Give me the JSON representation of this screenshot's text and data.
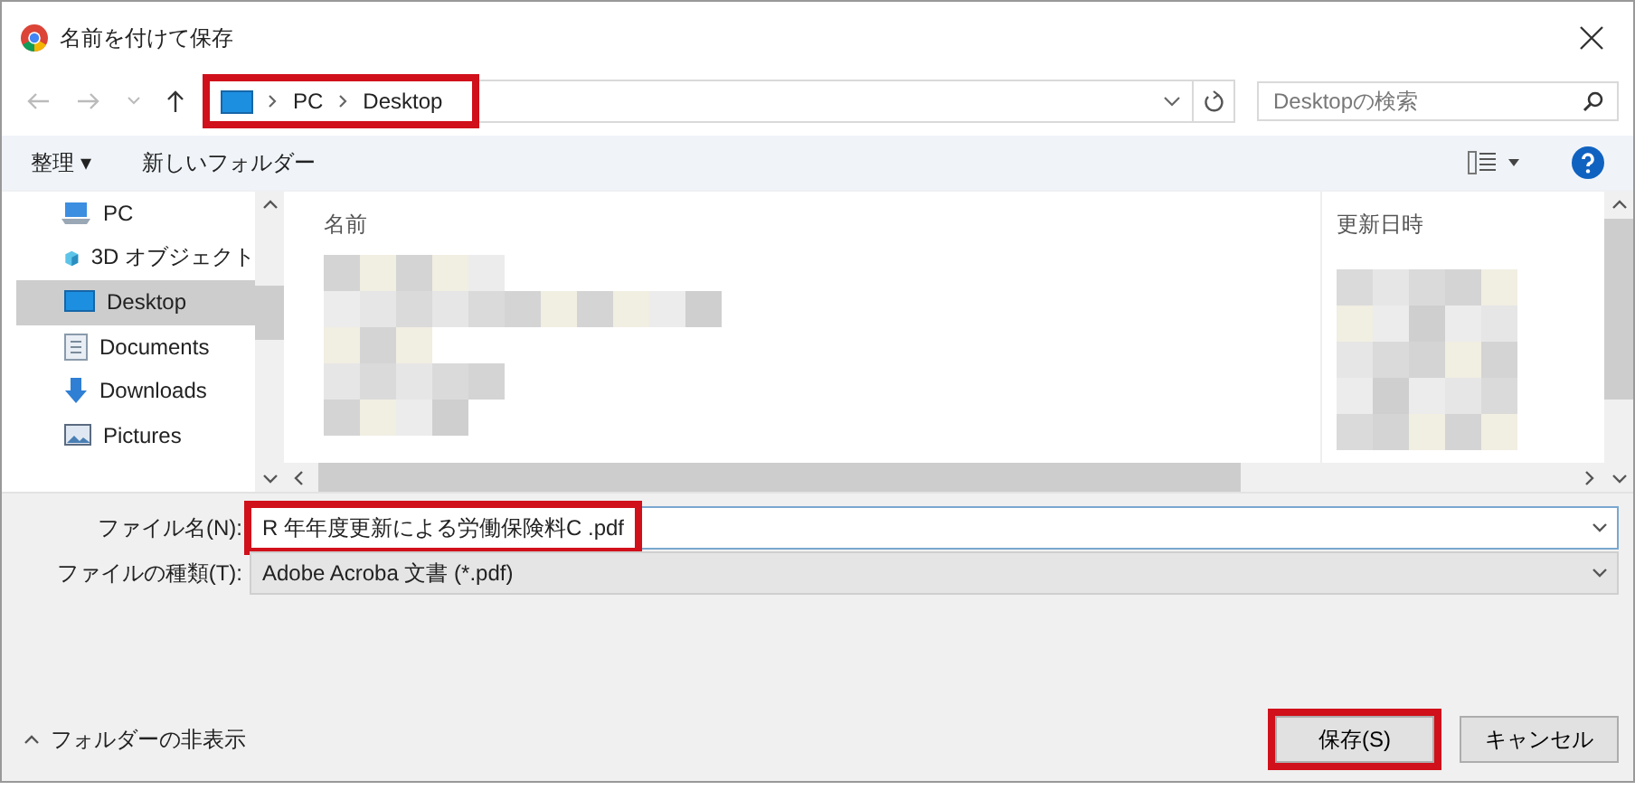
{
  "window": {
    "title": "名前を付けて保存"
  },
  "address_bar": {
    "highlighted": true,
    "crumbs": [
      "PC",
      "Desktop"
    ]
  },
  "search": {
    "placeholder": "Desktopの検索"
  },
  "toolbar": {
    "organize": "整理 ▾",
    "new_folder": "新しいフォルダー"
  },
  "sidebar": {
    "items": [
      {
        "label": "PC",
        "kind": "pc",
        "selected": false
      },
      {
        "label": "3D オブジェクト",
        "kind": "cube",
        "selected": false
      },
      {
        "label": "Desktop",
        "kind": "desktop",
        "selected": true
      },
      {
        "label": "Documents",
        "kind": "document",
        "selected": false
      },
      {
        "label": "Downloads",
        "kind": "download",
        "selected": false
      },
      {
        "label": "Pictures",
        "kind": "pictures",
        "selected": false
      }
    ]
  },
  "file_list": {
    "columns": [
      "名前",
      "更新日時"
    ]
  },
  "file_name": {
    "label": "ファイル名(N):",
    "value": "R 年年度更新による労働保険料C .pdf",
    "highlighted": true
  },
  "file_type": {
    "label": "ファイルの種類(T):",
    "value": "Adobe Acroba 文書 (*.pdf)"
  },
  "hide_folders": "フォルダーの非表示",
  "buttons": [
    {
      "label": "保存(S)",
      "highlighted": true
    },
    {
      "label": "キャンセル",
      "highlighted": false
    }
  ]
}
